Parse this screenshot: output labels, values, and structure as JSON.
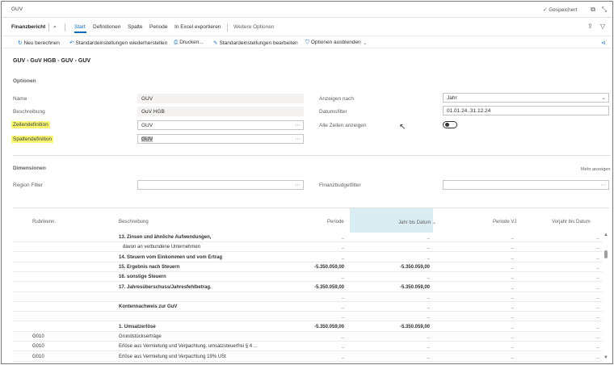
{
  "window": {
    "title": "GUV",
    "saved": "✓ Gespeichert"
  },
  "nav": {
    "app": "Finanzbericht",
    "tabs": [
      "Start",
      "Definitionen",
      "Spalte",
      "Periode",
      "In Excel exportieren"
    ],
    "more": "Weitere Optionen"
  },
  "actions": {
    "recalc": "Neu berechnen",
    "restore": "Standardeinstellungen wiederherstellen",
    "print": "Drucken...",
    "edit_defaults": "Standardeinstellungen bearbeiten",
    "hide_options": "Optionen ausblenden"
  },
  "page": {
    "title": "GUV - GuV HGB - GUV - GUV"
  },
  "options": {
    "heading": "Optionen",
    "name_label": "Name",
    "name_value": "GUV",
    "desc_label": "Beschreibung",
    "desc_value": "GuV HGB",
    "row_def_label": "Zeilendefinition",
    "row_def_value": "GUV",
    "col_def_label": "Spaltendefinition",
    "col_def_value": "GUV",
    "show_by_label": "Anzeigen nach",
    "show_by_value": "Jahr",
    "date_filter_label": "Datumsfilter",
    "date_filter_value": "01.01.24..31.12.24",
    "all_rows_label": "Alle Zeilen anzeigen"
  },
  "dimensions": {
    "heading": "Dimensionen",
    "more": "Mehr anzeigen",
    "region_label": "Region Filter",
    "budget_label": "Finanzbudgetfilter"
  },
  "grid": {
    "headers": [
      "Rubrikenn.",
      "Beschreibung",
      "Periode",
      "Jahr bis Datum",
      "Periode VJ",
      "Vorjahr bis Datum"
    ],
    "rows": [
      {
        "code": "",
        "desc": "13. Zinsen und ähnliche Aufwendungen,",
        "bold": true,
        "p": "_",
        "ytd": "_",
        "pvj": "_",
        "vytd": "_"
      },
      {
        "code": "",
        "desc": "davon an verbundene Unternehmen",
        "bold": false,
        "indent": true,
        "p": "_",
        "ytd": "_",
        "pvj": "_",
        "vytd": "_"
      },
      {
        "code": "",
        "desc": "14. Steuern vom Einkommen und vom Ertrag",
        "bold": true,
        "p": "_",
        "ytd": "_",
        "pvj": "_",
        "vytd": "_"
      },
      {
        "code": "",
        "desc": "15. Ergebnis nach Steuern",
        "bold": true,
        "p": "-5.350.059,00",
        "ytd": "-5.350.059,00",
        "pvj": "_",
        "vytd": "_"
      },
      {
        "code": "",
        "desc": "16. sonstige Steuern",
        "bold": true,
        "p": "_",
        "ytd": "_",
        "pvj": "_",
        "vytd": "_"
      },
      {
        "code": "",
        "desc": "17. Jahresüberschuss/Jahresfehlbetrag.",
        "bold": true,
        "p": "-5.350.059,00",
        "ytd": "-5.350.059,00",
        "pvj": "_",
        "vytd": "_"
      },
      {
        "code": "",
        "desc": "",
        "bold": false,
        "p": "_",
        "ytd": "_",
        "pvj": "_",
        "vytd": "_"
      },
      {
        "code": "",
        "desc": "Kontennachweis zur GuV",
        "bold": true,
        "p": "_",
        "ytd": "_",
        "pvj": "_",
        "vytd": "_"
      },
      {
        "code": "",
        "desc": "",
        "bold": false,
        "p": "_",
        "ytd": "_",
        "pvj": "_",
        "vytd": "_"
      },
      {
        "code": "",
        "desc": "1. Umsatzerlöse",
        "bold": true,
        "p": "-5.350.059,00",
        "ytd": "-5.350.059,00",
        "pvj": "_",
        "vytd": "_"
      },
      {
        "code": "G010",
        "desc": "Grundstückserträge",
        "bold": false,
        "p": "_",
        "ytd": "_",
        "pvj": "_",
        "vytd": "_"
      },
      {
        "code": "G010",
        "desc": "Erlöse aus Vermietung und Verpachtung, umsatzsteuerfrei § 4 ...",
        "bold": false,
        "p": "_",
        "ytd": "_",
        "pvj": "_",
        "vytd": "_"
      },
      {
        "code": "G010",
        "desc": "Erlöse aus Vermietung und Verpachtung 19% USt",
        "bold": false,
        "p": "_",
        "ytd": "_",
        "pvj": "_",
        "vytd": "_"
      }
    ]
  },
  "colors": {
    "accent": "#0f6cbd",
    "highlight": "#f5f572",
    "active_column": "#d9edf2"
  }
}
